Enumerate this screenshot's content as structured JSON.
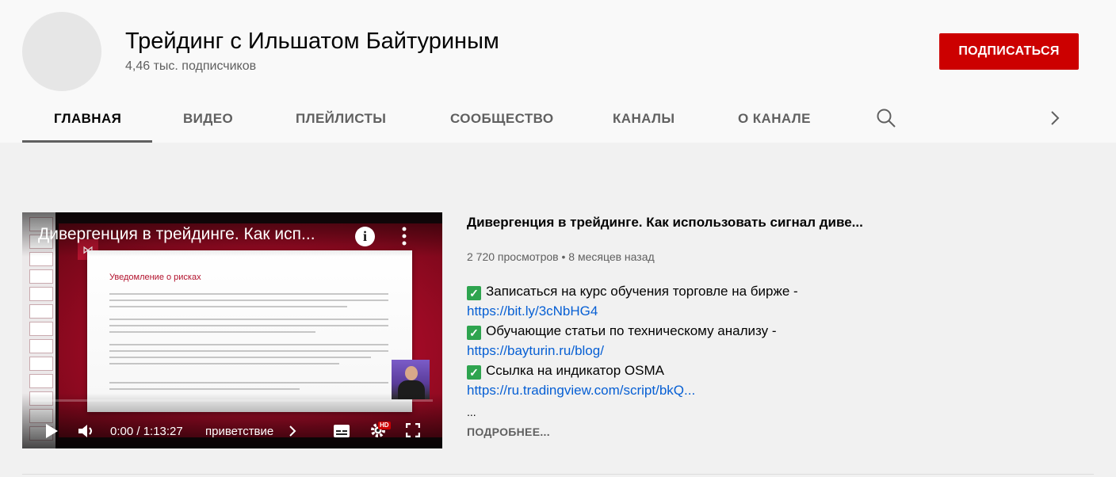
{
  "channel": {
    "name": "Трейдинг с Ильшатом Байтуриным",
    "subscribers": "4,46 тыс. подписчиков",
    "subscribe_label": "ПОДПИСАТЬСЯ"
  },
  "tabs": [
    {
      "label": "ГЛАВНАЯ",
      "active": true
    },
    {
      "label": "ВИДЕО"
    },
    {
      "label": "ПЛЕЙЛИСТЫ"
    },
    {
      "label": "СООБЩЕСТВО"
    },
    {
      "label": "КАНАЛЫ"
    },
    {
      "label": "О КАНАЛЕ"
    }
  ],
  "player": {
    "title": "Дивергенция в трейдинге. Как исп...",
    "time": "0:00 / 1:13:27",
    "chapter": "приветствие",
    "hd_badge": "HD",
    "slide_heading": "Уведомление о рисках",
    "progress": 0.0
  },
  "video": {
    "title": "Дивергенция в трейдинге. Как использовать сигнал  диве...",
    "meta": "2 720 просмотров • 8 месяцев назад",
    "description": [
      {
        "text": "Записаться на курс  обучения  торговле на бирже -",
        "link": "https://bit.ly/3cNbHG4"
      },
      {
        "text": "Обучающие статьи по техническому анализу -",
        "link": "https://bayturin.ru/blog/"
      },
      {
        "text": "Ссылка на индикатор OSMA",
        "link": "https://ru.tradingview.com/script/bkQ..."
      }
    ],
    "ellipsis": "...",
    "more_label": "ПОДРОБНЕЕ..."
  },
  "colors": {
    "accent": "#cc0000",
    "link": "#065fd4",
    "check": "#2ea44f"
  },
  "icons": [
    "search-icon",
    "chevron-right-icon",
    "info-icon",
    "more-vert-icon",
    "play-icon",
    "volume-icon",
    "subtitles-icon",
    "settings-icon",
    "fullscreen-icon",
    "check-icon"
  ]
}
